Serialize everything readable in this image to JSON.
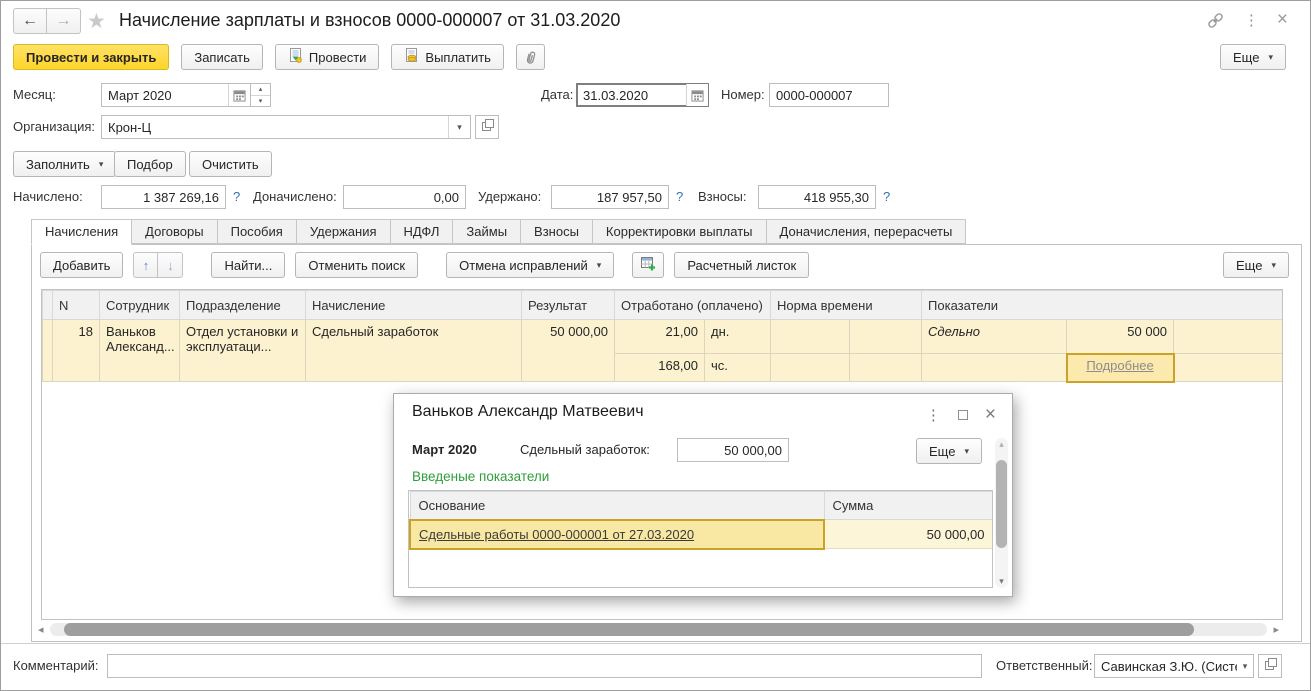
{
  "header": {
    "title": "Начисление зарплаты и взносов 0000-000007 от 31.03.2020"
  },
  "toolbar": {
    "post_close": "Провести и закрыть",
    "save": "Записать",
    "post": "Провести",
    "pay": "Выплатить",
    "more": "Еще"
  },
  "fields": {
    "month_label": "Месяц:",
    "month_value": "Март 2020",
    "date_label": "Дата:",
    "date_value": "31.03.2020",
    "number_label": "Номер:",
    "number_value": "0000-000007",
    "org_label": "Организация:",
    "org_value": "Крон-Ц"
  },
  "fill_bar": {
    "fill": "Заполнить",
    "pick": "Подбор",
    "clear": "Очистить"
  },
  "totals": {
    "accrued_label": "Начислено:",
    "accrued_value": "1 387 269,16",
    "extra_label": "Доначислено:",
    "extra_value": "0,00",
    "withheld_label": "Удержано:",
    "withheld_value": "187 957,50",
    "contrib_label": "Взносы:",
    "contrib_value": "418 955,30",
    "help_mark": "?"
  },
  "tabs": [
    "Начисления",
    "Договоры",
    "Пособия",
    "Удержания",
    "НДФЛ",
    "Займы",
    "Взносы",
    "Корректировки выплаты",
    "Доначисления, перерасчеты"
  ],
  "grid_toolbar": {
    "add": "Добавить",
    "find": "Найти...",
    "cancel_search": "Отменить поиск",
    "cancel_fixes": "Отмена исправлений",
    "payslip": "Расчетный листок",
    "more": "Еще"
  },
  "grid": {
    "headers": {
      "n": "N",
      "employee": "Сотрудник",
      "department": "Подразделение",
      "accrual": "Начисление",
      "result": "Результат",
      "worked": "Отработано (оплачено)",
      "norm": "Норма времени",
      "indicators": "Показатели"
    },
    "row": {
      "n": "18",
      "employee": "Ваньков Александ...",
      "department": "Отдел установки и эксплуатаци...",
      "accrual": "Сдельный заработок",
      "result": "50 000,00",
      "worked_days": "21,00",
      "worked_days_unit": "дн.",
      "worked_hours": "168,00",
      "worked_hours_unit": "чс.",
      "indicator_name": "Сдельно",
      "indicator_value": "50 000",
      "details": "Подробнее"
    }
  },
  "dialog": {
    "title": "Ваньков Александр Матвеевич",
    "period": "Март 2020",
    "amount_label": "Сдельный заработок:",
    "amount_value": "50 000,00",
    "more": "Еще",
    "section": "Введеные показатели",
    "col_basis": "Основание",
    "col_sum": "Сумма",
    "row_basis": "Сдельные работы 0000-000001 от 27.03.2020",
    "row_sum": "50 000,00"
  },
  "footer": {
    "comment_label": "Комментарий:",
    "responsible_label": "Ответственный:",
    "responsible_value": "Савинская З.Ю. (Системн"
  },
  "colors": {
    "accent_yellow": "#ffd52a",
    "row_highlight": "#fcf2cf",
    "cell_selected": "#fbe9ad",
    "selection_border": "#c9a227",
    "help_blue": "#3572b0",
    "heading_green": "#2e9e3a"
  }
}
